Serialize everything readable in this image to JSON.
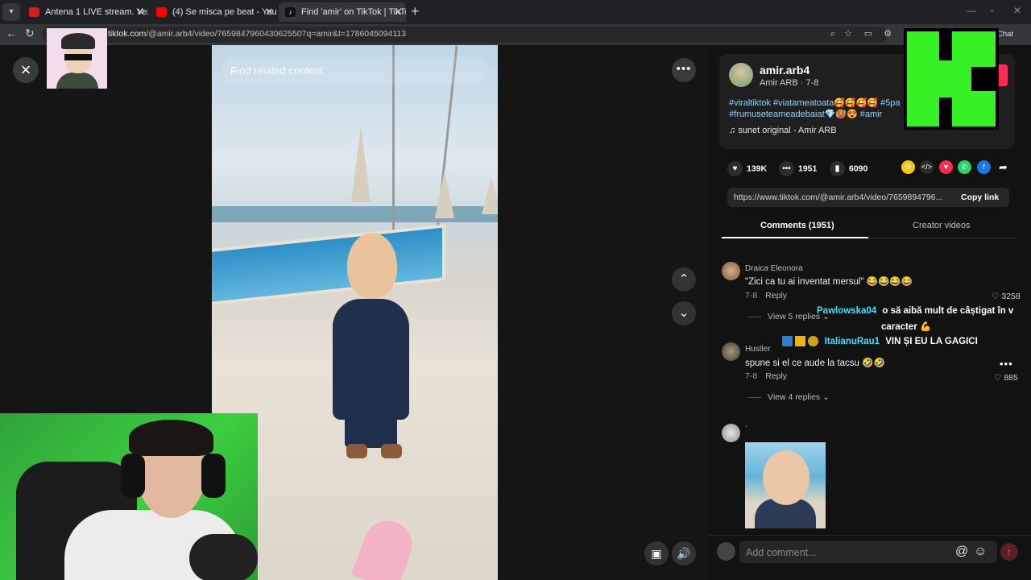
{
  "browser": {
    "tabs": [
      {
        "title": "Antena 1 LIVE stream. Vezi online",
        "fav_color": "#cc1f1f"
      },
      {
        "title": "(4) Se misca pe beat - YouTube",
        "fav_color": "#ff0000"
      },
      {
        "title": "Find 'amir' on TikTok | TikTok",
        "fav_color": "#111111"
      }
    ],
    "url_host": "tiktok.com",
    "url_path": "/@amir.arb4/video/7659847960430625507q=amir&t=1786045094113",
    "chat_label": "Chat"
  },
  "video": {
    "search_placeholder": "Find related content"
  },
  "author": {
    "name": "amir.arb4",
    "sub": "Amir ARB · 7-8",
    "hashtags": "#viraltiktok #viatameatoata🥰🥰🥰🥰 #5pa #frumuseteameadebaiat💎🥵😍 #amir",
    "music": "sunet original - Amir ARB"
  },
  "stats": {
    "likes": "139K",
    "comments": "1951",
    "saves": "6090"
  },
  "share_link": {
    "url": "https://www.tiktok.com/@amir.arb4/video/7659894796...",
    "copy_label": "Copy link"
  },
  "comment_tabs": {
    "comments": "Comments (1951)",
    "creator": "Creator videos"
  },
  "comments": [
    {
      "user": "Draica Eleonora",
      "text": "\"Zici ca tu ai inventat mersul\" 😂😂😂😂",
      "date": "7-8",
      "reply_label": "Reply",
      "likes": "3258",
      "replies": "View 5 replies"
    },
    {
      "user": "Hustler",
      "text": "spune si el ce aude la tacsu 🤣🤣",
      "date": "7-8",
      "reply_label": "Reply",
      "likes": "885",
      "replies": "View 4 replies"
    },
    {
      "user": "."
    }
  ],
  "stream_chat": [
    {
      "user": "Pawlowska04",
      "message_line1": "o să aibă mult de câștigat în v",
      "message_line2": "caracter 💪",
      "user_color": "#35e0ff"
    },
    {
      "user": "ItalianuRau1",
      "message": "VIN ȘI EU LA GAGICI",
      "user_color": "#35e0ff"
    }
  ],
  "comment_input": {
    "placeholder": "Add comment..."
  },
  "colors": {
    "brand_pink": "#fe2c55",
    "hashtag_blue": "#8fd3ff",
    "greenscreen": "#35f022"
  }
}
